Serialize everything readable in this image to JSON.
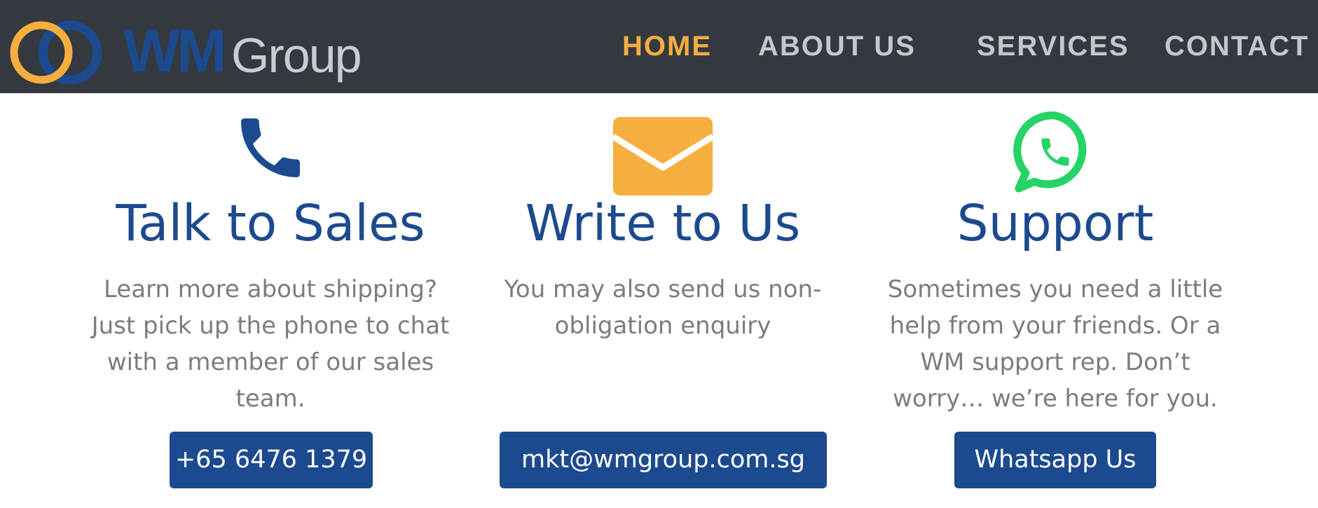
{
  "header": {
    "logo": {
      "primary": "WM",
      "secondary": "Group"
    },
    "nav": [
      {
        "label": "HOME",
        "active": true
      },
      {
        "label": "ABOUT US",
        "active": false
      },
      {
        "label": "SERVICES",
        "active": false
      },
      {
        "label": "CONTACT",
        "active": false
      }
    ]
  },
  "cards": [
    {
      "icon": "phone-icon",
      "title": "Talk to Sales",
      "description": "Learn more about shipping? Just pick up the phone to chat with a member of our sales team.",
      "button": "+65 6476 1379"
    },
    {
      "icon": "envelope-icon",
      "title": "Write to Us",
      "description": "You may also send us non-obligation enquiry",
      "button": "mkt@wmgroup.com.sg"
    },
    {
      "icon": "whatsapp-icon",
      "title": "Support",
      "description": "Sometimes you need a little help from your friends. Or a WM support rep. Don’t worry… we’re here for you.",
      "button": "Whatsapp Us"
    }
  ],
  "colors": {
    "header_bg": "#343940",
    "accent_orange": "#f6ae3f",
    "brand_blue": "#1c4a8f",
    "nav_text": "#c4c7cb",
    "body_text": "#7a7c80",
    "whatsapp_green": "#25d366"
  }
}
